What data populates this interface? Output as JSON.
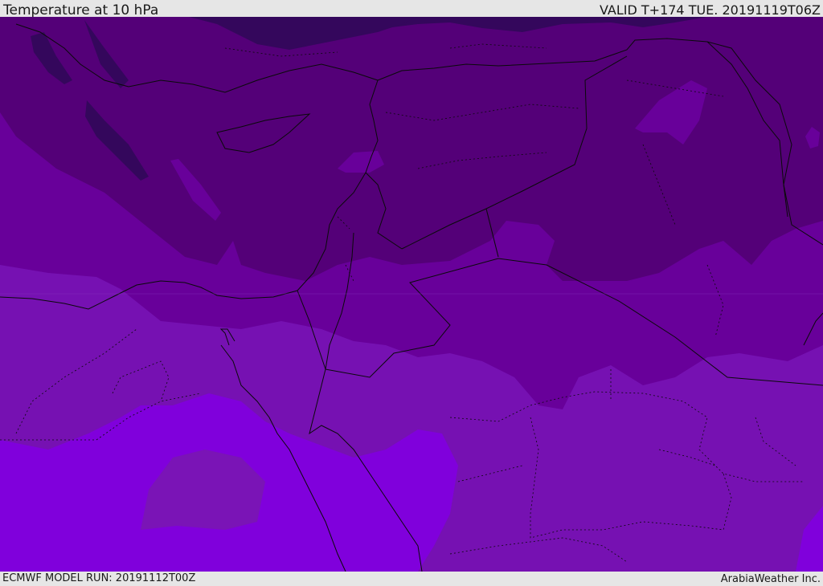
{
  "header": {
    "title": "Temperature at 10 hPa",
    "valid_time": "VALID T+174 TUE. 20191119T06Z"
  },
  "footer": {
    "model_run": "ECMWF MODEL RUN: 20191112T00Z",
    "credit": "ArabiaWeather Inc."
  },
  "map": {
    "variable": "temperature",
    "level_hpa": 10,
    "colors": {
      "coldest": "#34075c",
      "very_cold": "#540078",
      "cold": "#68009a",
      "mid": "#7611b2",
      "warm": "#7a14b6",
      "warmest": "#8000dc",
      "borders": "#0a0a0a"
    }
  }
}
